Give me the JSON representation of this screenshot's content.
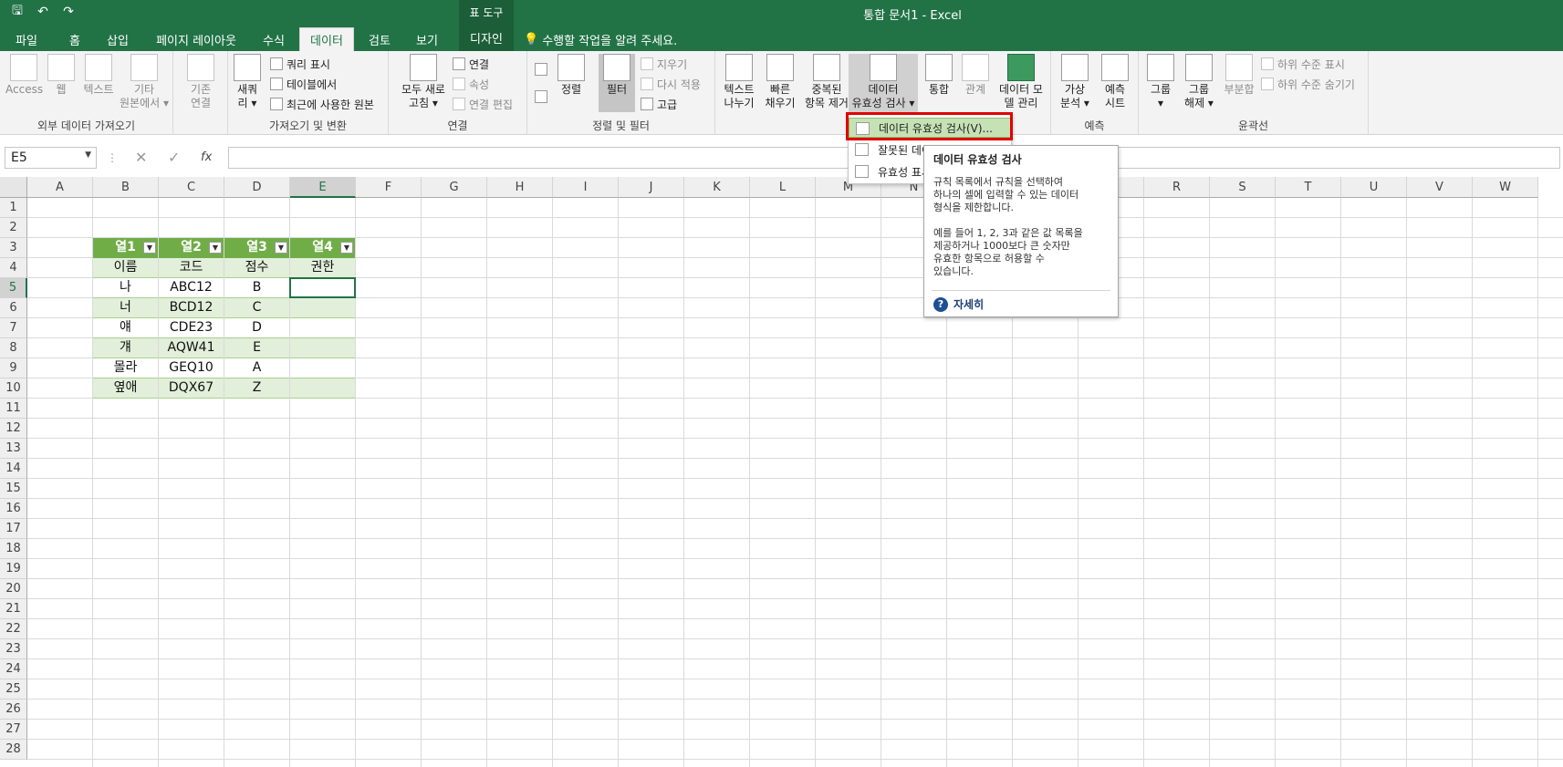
{
  "window": {
    "title": "통합 문서1 - Excel",
    "context_group": "표 도구"
  },
  "qat": {
    "save": "🖫",
    "undo": "↶",
    "redo": "↷"
  },
  "tabs": [
    "파일",
    "홈",
    "삽입",
    "페이지 레이아웃",
    "수식",
    "데이터",
    "검토",
    "보기",
    "디자인"
  ],
  "active_tab": "데이터",
  "tell_me": "수행할 작업을 알려 주세요.",
  "ribbon": {
    "get_external": {
      "label": "외부 데이터 가져오기",
      "items": [
        "Access",
        "웹",
        "텍스트",
        "기타\n원본에서 ▾",
        "기존\n연결"
      ]
    },
    "get_transform": {
      "label": "가져오기 및 변환",
      "new_query": "새쿼\n리 ▾",
      "items": [
        "쿼리 표시",
        "테이블에서",
        "최근에 사용한 원본"
      ]
    },
    "connections": {
      "label": "연결",
      "refresh_all": "모두 새로\n고침 ▾",
      "items": [
        "연결",
        "속성",
        "연결 편집"
      ]
    },
    "sort_filter": {
      "label": "정렬 및 필터",
      "sort": "정렬",
      "filter": "필터",
      "items": [
        "지우기",
        "다시 적용",
        "고급"
      ]
    },
    "data_tools": {
      "items": [
        "텍스트\n나누기",
        "빠른\n채우기",
        "중복된\n항목 제거",
        "데이터\n유효성 검사 ▾",
        "통합",
        "관계",
        "데이터 모\n델 관리"
      ]
    },
    "forecast": {
      "label": "예측",
      "items": [
        "가상\n분석 ▾",
        "예측\n시트"
      ]
    },
    "outline": {
      "label": "윤곽선",
      "items": [
        "그룹\n▾",
        "그룹\n해제 ▾",
        "부분합"
      ],
      "small": [
        "하위 수준 표시",
        "하위 수준 숨기기"
      ]
    }
  },
  "formula_bar": {
    "name_box": "E5",
    "fx": "fx",
    "value": ""
  },
  "columns": [
    "A",
    "B",
    "C",
    "D",
    "E",
    "F",
    "G",
    "H",
    "I",
    "J",
    "K",
    "L",
    "M",
    "N",
    "O",
    "P",
    "Q",
    "R",
    "S",
    "T",
    "U",
    "V",
    "W"
  ],
  "rows": [
    "1",
    "2",
    "3",
    "4",
    "5",
    "6",
    "7",
    "8",
    "9",
    "10",
    "11",
    "12",
    "13",
    "14",
    "15",
    "16",
    "17",
    "18",
    "19",
    "20",
    "21",
    "22",
    "23",
    "24",
    "25",
    "26",
    "27",
    "28"
  ],
  "table": {
    "headers": [
      "열1",
      "열2",
      "열3",
      "열4"
    ],
    "rows": [
      [
        "이름",
        "코드",
        "점수",
        "권한"
      ],
      [
        "나",
        "ABC12",
        "B",
        ""
      ],
      [
        "너",
        "BCD12",
        "C",
        ""
      ],
      [
        "얘",
        "CDE23",
        "D",
        ""
      ],
      [
        "걔",
        "AQW41",
        "E",
        ""
      ],
      [
        "몰라",
        "GEQ10",
        "A",
        ""
      ],
      [
        "옆애",
        "DQX67",
        "Z",
        ""
      ]
    ]
  },
  "dropdown": {
    "items": [
      "데이터 유효성 검사(V)...",
      "잘못된 데이터",
      "유효성 표시"
    ]
  },
  "tooltip": {
    "title": "데이터 유효성 검사",
    "body": "규칙 목록에서 규칙을 선택하여\n하나의 셀에 입력할 수 있는 데이터\n형식을 제한합니다.\n\n예를 들어 1, 2, 3과 같은 값 목록을\n제공하거나 1000보다 큰 숫자만\n유효한 항목으로 허용할 수\n있습니다.",
    "more": "자세히",
    "help_glyph": "?"
  },
  "colors": {
    "brand": "#217346",
    "table_header": "#70ad47",
    "table_band": "#e2efda",
    "highlight_box": "#e00000"
  }
}
